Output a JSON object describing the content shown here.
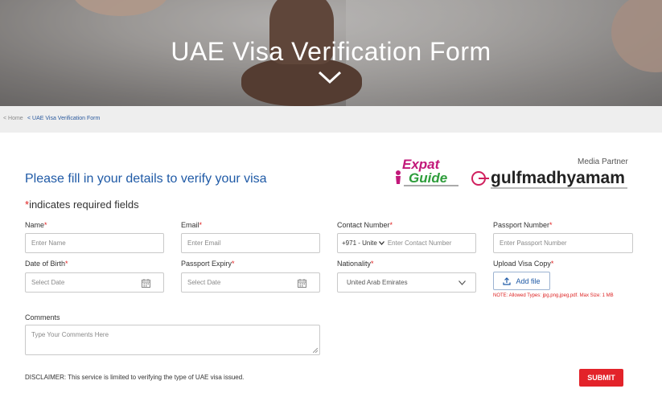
{
  "hero": {
    "title": "UAE Visa Verification Form"
  },
  "breadcrumb": {
    "home": "< Home",
    "current": "< UAE Visa Verification Form"
  },
  "form": {
    "heading": "Please fill in your details to verify your visa",
    "required_star": "*",
    "required_text": "indicates required fields",
    "fields": {
      "name": {
        "label": "Name",
        "star": "*",
        "placeholder": "Enter Name"
      },
      "email": {
        "label": "Email",
        "star": "*",
        "placeholder": "Enter Email"
      },
      "contact": {
        "label": "Contact Number",
        "star": "*",
        "code": "+971 - Unite",
        "placeholder": "Enter Contact Number"
      },
      "passport": {
        "label": "Passport Number",
        "star": "*",
        "placeholder": "Enter Passport Number"
      },
      "dob": {
        "label": "Date of Birth",
        "star": "*",
        "placeholder": "Select Date"
      },
      "passport_expiry": {
        "label": "Passport Expiry",
        "star": "*",
        "placeholder": "Select Date"
      },
      "nationality": {
        "label": "Nationality",
        "star": "*",
        "value": "United Arab Emirates"
      },
      "upload": {
        "label": "Upload Visa Copy",
        "star": "*",
        "button": "Add file",
        "note": "NOTE: Allowed Types: jpg,png,jpeg,pdf. Max Size: 1 MB"
      },
      "comments": {
        "label": "Comments",
        "placeholder": "Type Your Comments Here"
      }
    },
    "disclaimer": "DISCLAIMER: This service is limited to verifying the type of UAE visa issued.",
    "submit": "SUBMIT"
  },
  "partners": {
    "media_partner_label": "Media Partner",
    "expat_logo": [
      "Expat",
      "Guide"
    ],
    "gulf_logo": "gulfmadhyamam"
  },
  "colors": {
    "accent_blue": "#1f5aa6",
    "required_red": "#e02020",
    "submit_red": "#e3232a",
    "expat_magenta": "#c2187a",
    "expat_green": "#2e9d3b"
  }
}
